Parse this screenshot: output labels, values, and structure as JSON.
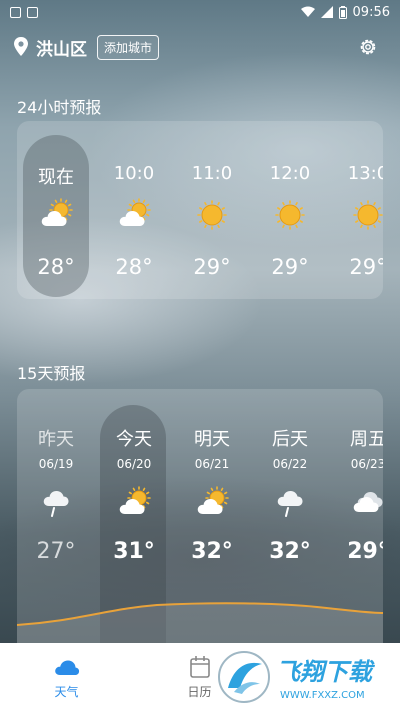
{
  "status_bar": {
    "time": "09:56"
  },
  "header": {
    "city": "洪山区",
    "add_city_label": "添加城市"
  },
  "hourly": {
    "title": "24小时预报",
    "items": [
      {
        "time": "现在",
        "icon": "partly-cloudy-icon",
        "temp": "28°",
        "active": true
      },
      {
        "time": "10:0",
        "icon": "partly-cloudy-icon",
        "temp": "28°"
      },
      {
        "time": "11:0",
        "icon": "sunny-icon",
        "temp": "29°"
      },
      {
        "time": "12:0",
        "icon": "sunny-icon",
        "temp": "29°"
      },
      {
        "time": "13:0",
        "icon": "sunny-icon",
        "temp": "29°"
      }
    ]
  },
  "daily": {
    "title": "15天预报",
    "items": [
      {
        "name": "昨天",
        "date": "06/19",
        "icon": "rain-icon",
        "temp": "27°",
        "past": true
      },
      {
        "name": "今天",
        "date": "06/20",
        "icon": "partly-cloudy-icon",
        "temp": "31°",
        "active": true
      },
      {
        "name": "明天",
        "date": "06/21",
        "icon": "partly-cloudy-icon",
        "temp": "32°"
      },
      {
        "name": "后天",
        "date": "06/22",
        "icon": "rain-icon",
        "temp": "32°"
      },
      {
        "name": "周五",
        "date": "06/23",
        "icon": "cloudy-icon",
        "temp": "29°"
      }
    ]
  },
  "bottom_nav": [
    {
      "label": "天气",
      "icon": "weather-cloud-icon",
      "active": true
    },
    {
      "label": "日历",
      "icon": "calendar-icon"
    },
    {
      "label": "",
      "icon": ""
    }
  ],
  "watermark": {
    "title": "飞翔下载",
    "url": "WWW.FXXZ.COM"
  },
  "colors": {
    "accent": "#2b8ce8",
    "curve": "#e8a23a",
    "sun": "#f5b82e"
  }
}
